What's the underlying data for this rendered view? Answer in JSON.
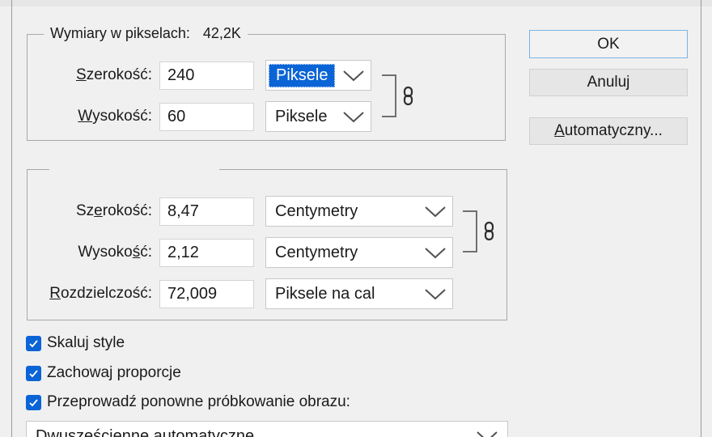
{
  "pixel_dimensions": {
    "legend_label": "Wymiary w pikselach:",
    "legend_value": "42,2K",
    "width": {
      "label": "Szerokość:",
      "value": "240",
      "unit": "Piksele"
    },
    "height": {
      "label": "Wysokość:",
      "value": "60",
      "unit": "Piksele"
    }
  },
  "document_size": {
    "width": {
      "label": "Szerokość:",
      "value": "8,47",
      "unit": "Centymetry"
    },
    "height": {
      "label": "Wysokość:",
      "value": "2,12",
      "unit": "Centymetry"
    },
    "resolution": {
      "label": "Rozdzielczość:",
      "value": "72,009",
      "unit": "Piksele na cal"
    }
  },
  "buttons": {
    "ok": "OK",
    "cancel": "Anuluj",
    "auto": "Automatyczny..."
  },
  "options": {
    "scale_styles": "Skaluj style",
    "constrain": "Zachowaj proporcje",
    "resample": "Przeprowadź ponowne próbkowanie obrazu:",
    "resample_method": "Dwusześcienne automatyczne"
  },
  "colors": {
    "accent": "#0a64d6",
    "default_border": "#7ab2e6",
    "background": "#f0f0f0"
  },
  "icons": [
    "chain-link-icon",
    "chevron-down-icon",
    "checkmark-icon"
  ]
}
